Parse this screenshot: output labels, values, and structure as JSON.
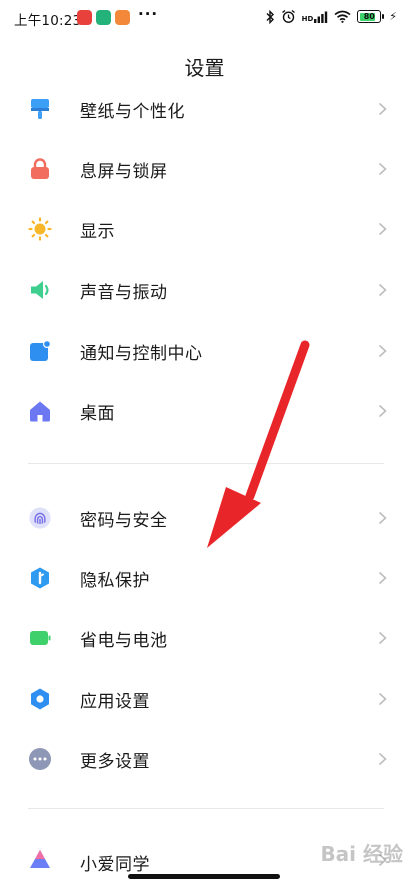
{
  "status_bar": {
    "time": "上午10:23",
    "more_dots": "···",
    "network_hd": "HD",
    "battery_level": "80",
    "battery_fill": 0.8
  },
  "header": {
    "title": "设置"
  },
  "settings": [
    {
      "label": "壁纸与个性化",
      "icon": "wallpaper-icon",
      "color": "#3d9ef5"
    },
    {
      "label": "息屏与锁屏",
      "icon": "lock-icon",
      "color": "#f36d5f"
    },
    {
      "label": "显示",
      "icon": "sun-icon",
      "color": "#f8b62b"
    },
    {
      "label": "声音与振动",
      "icon": "speaker-icon",
      "color": "#3ecf8e"
    },
    {
      "label": "通知与控制中心",
      "icon": "notification-icon",
      "color": "#2f8ff0"
    },
    {
      "label": "桌面",
      "icon": "home-icon",
      "color": "#6c78f2"
    },
    {
      "label": "密码与安全",
      "icon": "fingerprint-icon",
      "color": "#7a72e6"
    },
    {
      "label": "隐私保护",
      "icon": "privacy-shield-icon",
      "color": "#2e9af0"
    },
    {
      "label": "省电与电池",
      "icon": "battery-icon",
      "color": "#3ed06a"
    },
    {
      "label": "应用设置",
      "icon": "gear-icon",
      "color": "#2f8ff0"
    },
    {
      "label": "更多设置",
      "icon": "more-icon",
      "color": "#8e97b5"
    },
    {
      "label": "小爱同学",
      "icon": "xiaoai-icon",
      "color": "#6a7ff5"
    }
  ],
  "watermark": "Bai 经验",
  "colors": {
    "annotation_arrow": "#e8262a",
    "chevron": "#bdbdbd"
  }
}
